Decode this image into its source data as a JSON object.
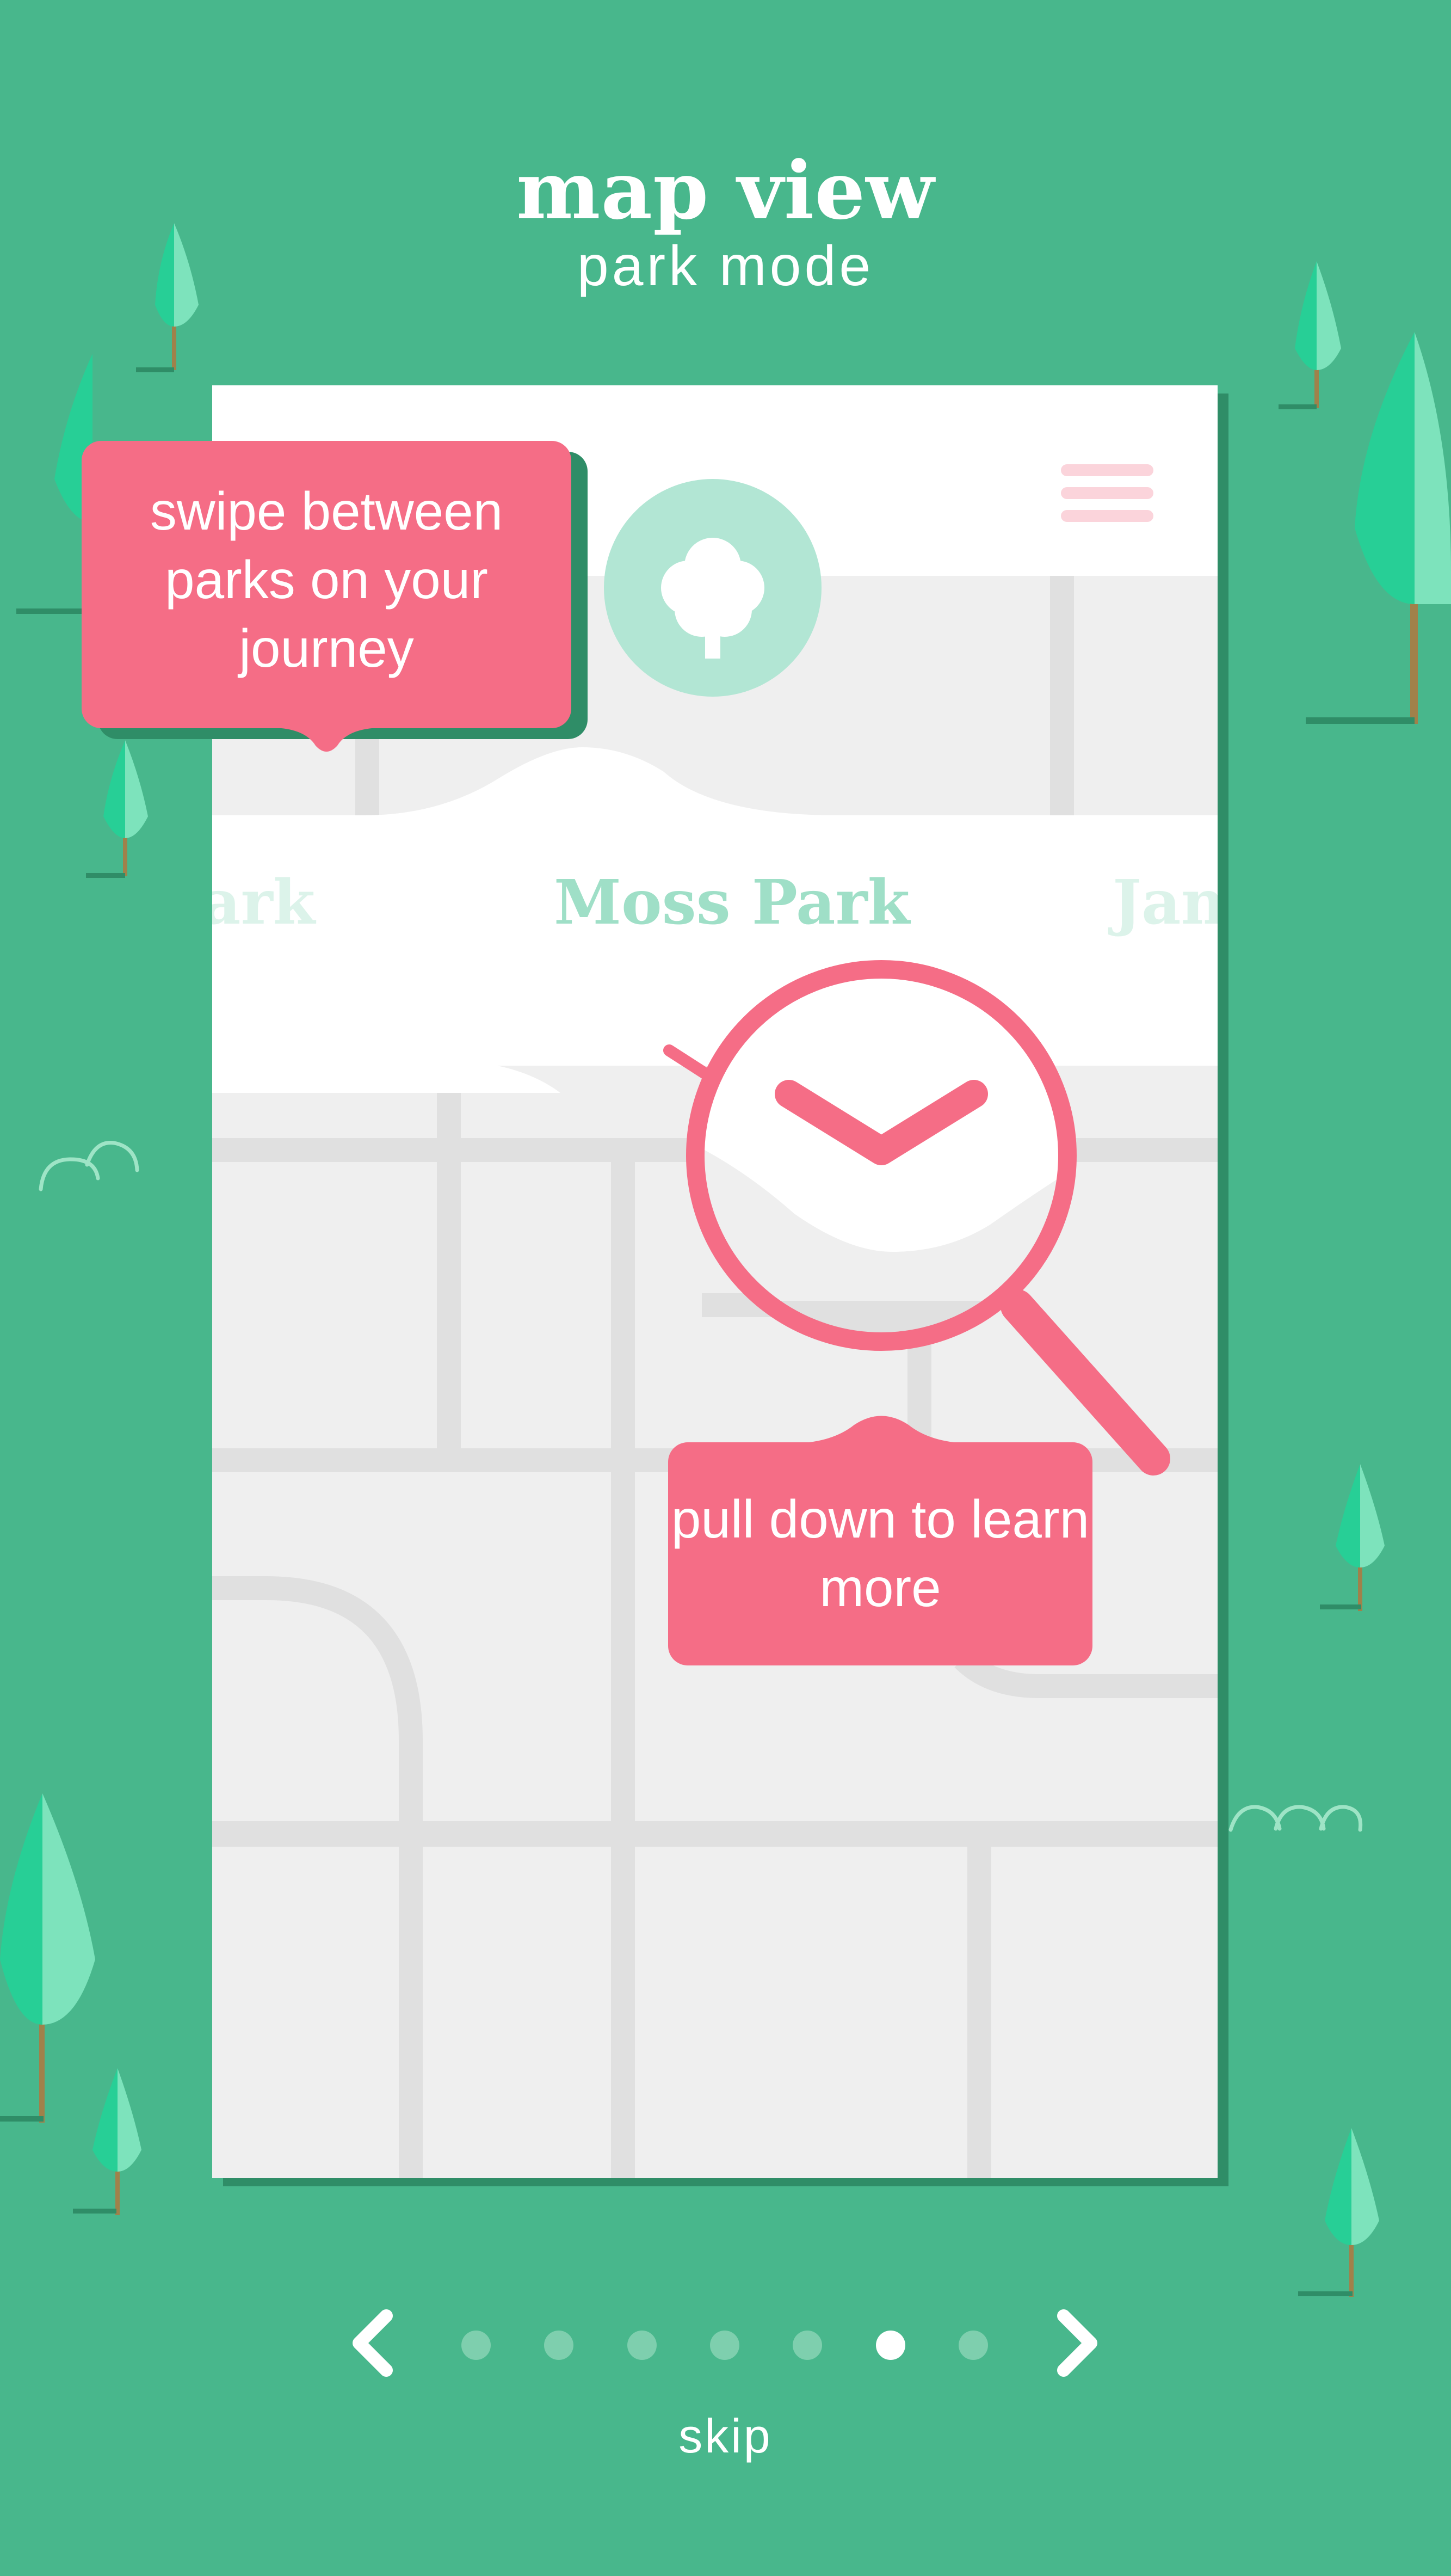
{
  "header": {
    "title": "map view",
    "subtitle": "park mode"
  },
  "phone": {
    "menu_icon": "hamburger-menu-icon",
    "park_icon": "tree-icon",
    "parks": {
      "previous": "ark",
      "current": "Moss Park",
      "next": "Jan"
    },
    "pull_indicator_icon": "chevron-down-icon",
    "magnifier_icon": "magnifier-icon"
  },
  "callouts": {
    "swipe": "swipe between parks on your journey",
    "pull": "pull down to learn more"
  },
  "pager": {
    "prev_icon": "chevron-left-icon",
    "next_icon": "chevron-right-icon",
    "total_pages": 7,
    "current_page": 6,
    "skip_label": "skip"
  },
  "colors": {
    "background": "#48b78c",
    "accent": "#f56d86",
    "park_green": "#9fdfc7",
    "map_bg": "#efefef",
    "road": "#e0e0e0"
  }
}
